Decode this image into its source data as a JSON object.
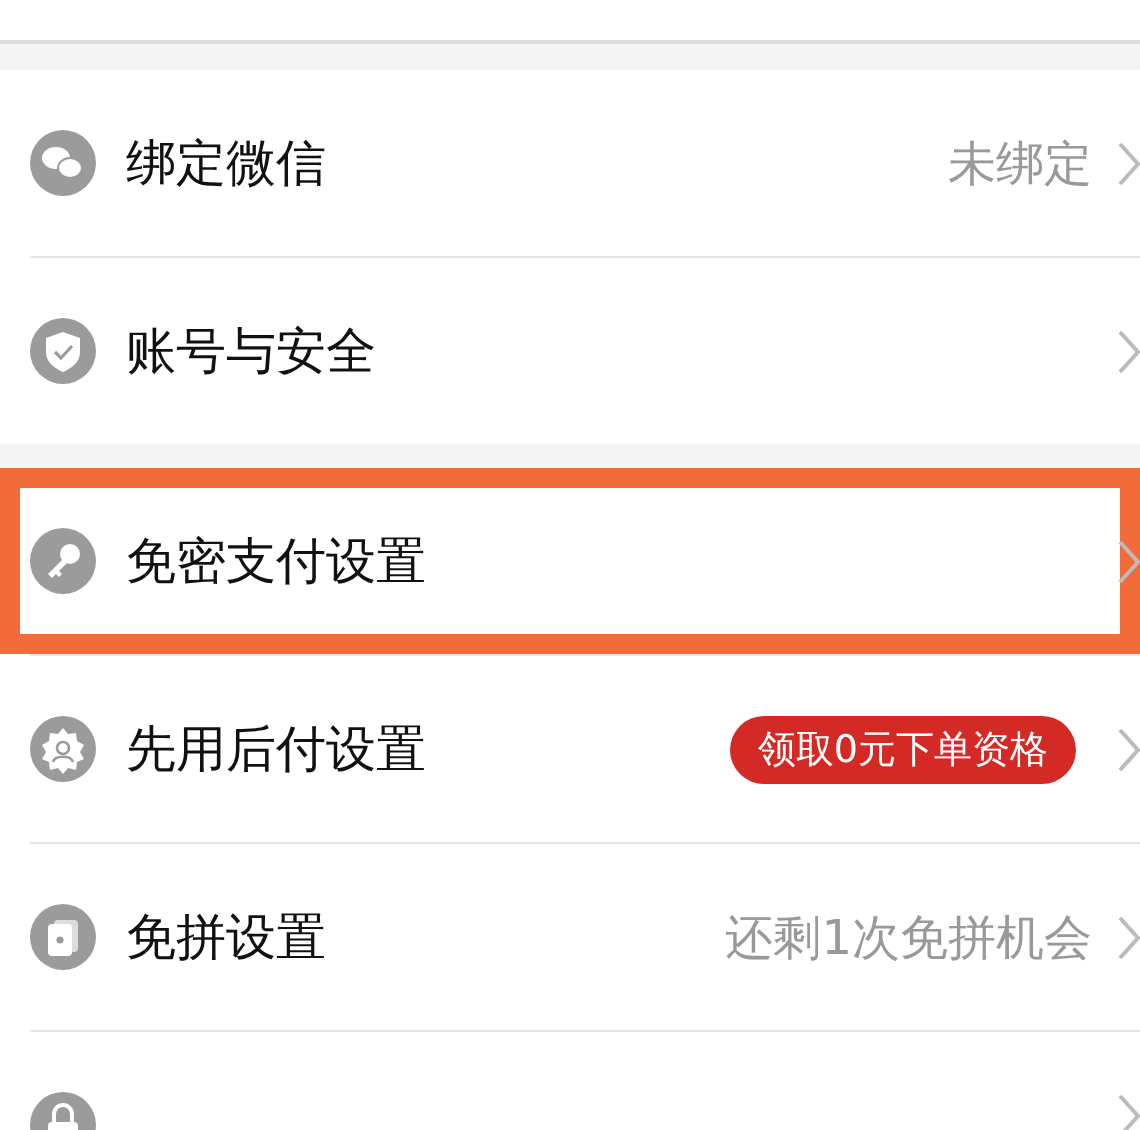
{
  "groups": [
    {
      "items": [
        {
          "kind": "row",
          "title": "绑定微信",
          "value": "未绑定",
          "highlighted": false
        },
        {
          "kind": "row",
          "title": "账号与安全",
          "highlighted": false
        }
      ]
    },
    {
      "items": [
        {
          "kind": "row",
          "title": "免密支付设置",
          "highlighted": true
        },
        {
          "kind": "row",
          "title": "先用后付设置",
          "badge": "领取0元下单资格",
          "highlighted": false
        },
        {
          "kind": "row",
          "title": "免拼设置",
          "value": "还剩1次免拼机会",
          "highlighted": false
        },
        {
          "kind": "cut"
        }
      ]
    }
  ]
}
